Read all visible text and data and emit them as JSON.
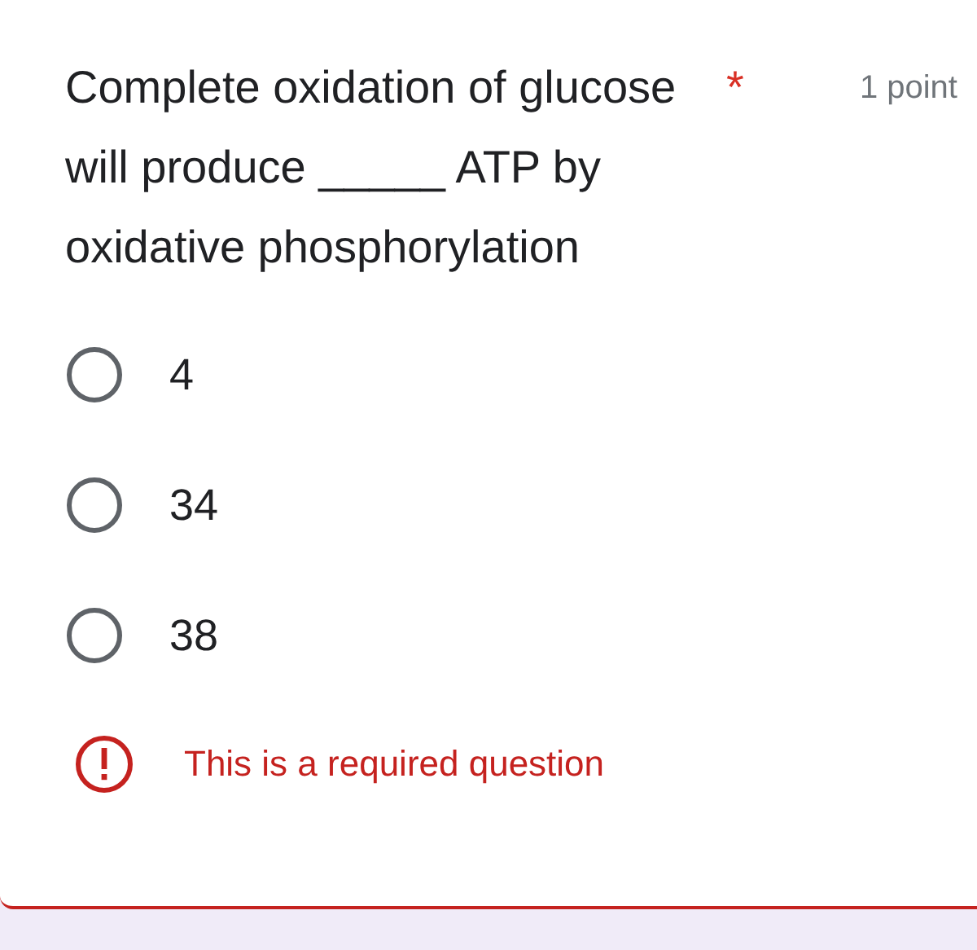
{
  "question": {
    "title": "Complete oxidation of glucose will produce _____ ATP by oxidative phosphorylation",
    "required": true,
    "required_mark": "*",
    "points": "1 point"
  },
  "options": [
    {
      "label": "4",
      "selected": false
    },
    {
      "label": "34",
      "selected": false
    },
    {
      "label": "38",
      "selected": false
    }
  ],
  "error": {
    "message": "This is a required question"
  }
}
